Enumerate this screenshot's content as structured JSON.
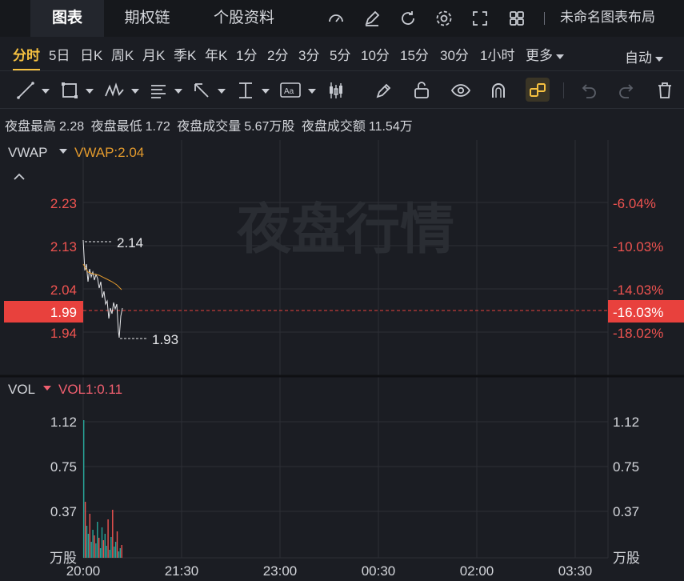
{
  "tabs": [
    {
      "label": "图表",
      "active": true
    },
    {
      "label": "期权链",
      "active": false
    },
    {
      "label": "个股资料",
      "active": false
    }
  ],
  "top_icons": [
    "gauge-icon",
    "edit-icon",
    "refresh-icon",
    "settings-icon",
    "fullscreen-icon",
    "grid-layout-icon"
  ],
  "layout_name": "未命名图表布局",
  "periods": [
    "分时",
    "5日",
    "日K",
    "周K",
    "月K",
    "季K",
    "年K",
    "1分",
    "2分",
    "3分",
    "5分",
    "10分",
    "15分",
    "30分",
    "1小时"
  ],
  "active_period": "分时",
  "more_label": "更多",
  "auto_label": "自动",
  "tools": [
    "trendline-icon",
    "rectangle-icon",
    "pattern-icon",
    "fib-icon",
    "arrow-icon",
    "measure-icon",
    "text-icon",
    "candle-icon",
    "pencil-icon",
    "lock-icon",
    "eye-icon",
    "magnet-icon",
    "link-icon",
    "undo-icon",
    "redo-icon",
    "trash-icon"
  ],
  "summary": {
    "high_label": "夜盘最高",
    "high": "2.28",
    "low_label": "夜盘最低",
    "low": "1.72",
    "vol_label": "夜盘成交量",
    "vol": "5.67万股",
    "amt_label": "夜盘成交额",
    "amt": "11.54万"
  },
  "watermark": "夜盘行情",
  "price_panel": {
    "indicator": "VWAP",
    "indicator_value": "VWAP:2.04",
    "y_ticks": [
      "2.23",
      "2.13",
      "2.04",
      "1.94"
    ],
    "pct_ticks": [
      "-6.04%",
      "-10.03%",
      "-14.03%",
      "-18.02%"
    ],
    "current_price": "1.99",
    "current_pct": "-16.03%",
    "high_marker": "2.14",
    "low_marker": "1.93"
  },
  "volume_panel": {
    "indicator": "VOL",
    "indicator_value": "VOL1:0.11",
    "y_ticks": [
      "1.12",
      "0.75",
      "0.37"
    ],
    "unit": "万股"
  },
  "x_ticks": [
    "20:00",
    "21:30",
    "23:00",
    "00:30",
    "02:00",
    "03:30"
  ],
  "colors": {
    "up": "#26a69a",
    "down": "#ef5350",
    "accent": "#f6c140",
    "vwap": "#e39a2d",
    "current": "#e8413d"
  }
}
